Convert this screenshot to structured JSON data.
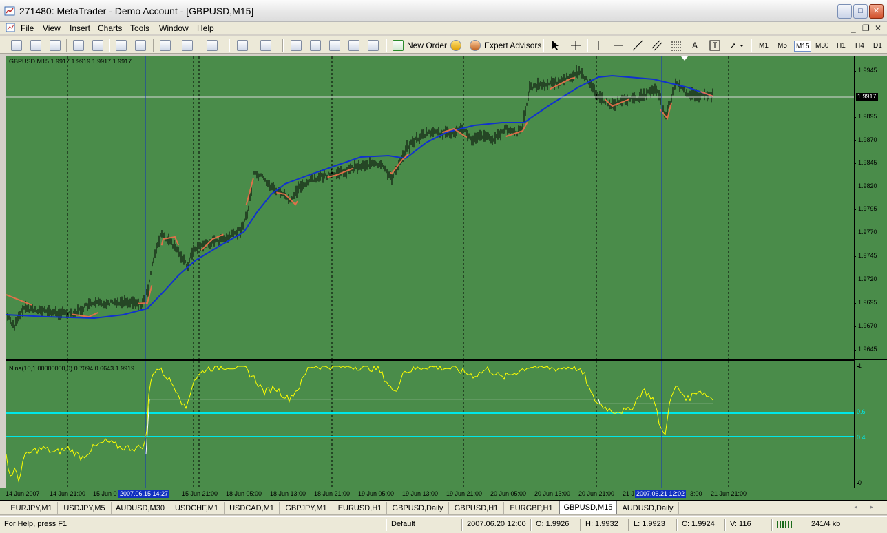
{
  "window": {
    "title": "271480: MetaTrader - Demo Account - [GBPUSD,M15]",
    "buttons": {
      "minimize": "_",
      "maximize": "□",
      "close": "✕"
    }
  },
  "menu": {
    "items": [
      "File",
      "View",
      "Insert",
      "Charts",
      "Tools",
      "Window",
      "Help"
    ],
    "mdi_controls": [
      "_",
      "❐",
      "✕"
    ]
  },
  "toolbar": {
    "new_order": "New Order",
    "expert_advisors": "Expert Advisors",
    "text_tool": "A",
    "timeframes": [
      "M1",
      "M5",
      "M15",
      "M30",
      "H1",
      "H4",
      "D1"
    ],
    "active_timeframe": "M15"
  },
  "main_chart": {
    "label": "GBPUSD,M15  1.9917 1.9919 1.9917 1.9917",
    "current_price": "1.9917",
    "price_ticks": [
      "1.9945",
      "1.9920",
      "1.9895",
      "1.9870",
      "1.9845",
      "1.9820",
      "1.9795",
      "1.9770",
      "1.9745",
      "1.9720",
      "1.9695",
      "1.9670",
      "1.9645"
    ]
  },
  "sub_chart": {
    "label": "Nina(10,1.00000000,0) 0.7094 0.6643 1.9919",
    "axis_top": "1",
    "axis_bottom": "0",
    "levels": [
      "0.6",
      "0.4"
    ]
  },
  "time_axis": {
    "ticks": [
      "14 Jun 2007",
      "14 Jun 21:00",
      "15 Jun 0",
      "15 Jun 21:00",
      "18 Jun 05:00",
      "18 Jun 13:00",
      "18 Jun 21:00",
      "19 Jun 05:00",
      "19 Jun 13:00",
      "19 Jun 21:00",
      "20 Jun 05:00",
      "20 Jun 13:00",
      "20 Jun 21:00",
      "21 J",
      "3:00",
      "21 Jun 21:00"
    ],
    "highlight_1": "2007.06.15 14:27",
    "highlight_2": "2007.06.21 12:02"
  },
  "tabs": {
    "items": [
      "EURJPY,M1",
      "USDJPY,M5",
      "AUDUSD,M30",
      "USDCHF,M1",
      "USDCAD,M1",
      "GBPJPY,M1",
      "EURUSD,H1",
      "GBPUSD,Daily",
      "GBPUSD,H1",
      "EURGBP,H1",
      "GBPUSD,M15",
      "AUDUSD,Daily"
    ],
    "active": "GBPUSD,M15",
    "arrows": "◂ ▸"
  },
  "status": {
    "help": "For Help, press F1",
    "profile": "Default",
    "datetime": "2007.06.20 12:00",
    "open": "O: 1.9926",
    "high": "H: 1.9932",
    "low": "L: 1.9923",
    "close": "C: 1.9924",
    "volume": "V: 116",
    "traffic": "241/4 kb"
  },
  "colors": {
    "chart_bg": "#4a8c4a",
    "ma_slow": "#1030d0",
    "ma_fast": "#e8704a",
    "indicator": "#ffff00",
    "signal": "#ffffff",
    "levels": "#00e8e8",
    "cursor_line": "#1030c0"
  }
}
